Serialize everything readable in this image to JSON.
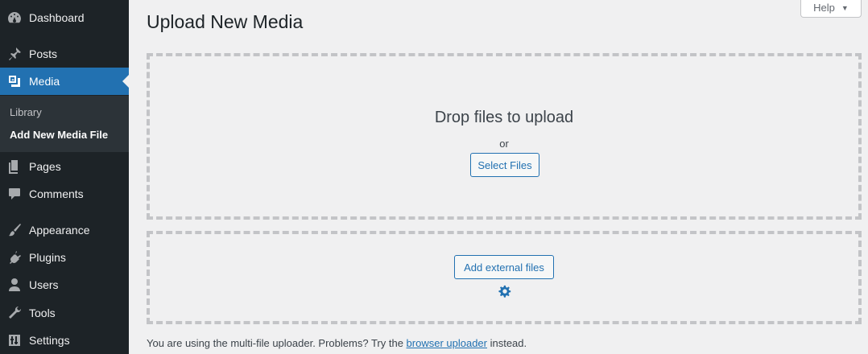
{
  "sidebar": {
    "items": [
      {
        "label": "Dashboard",
        "icon": "dashboard-icon"
      },
      {
        "label": "Posts",
        "icon": "pin-icon"
      },
      {
        "label": "Media",
        "icon": "media-icon"
      },
      {
        "label": "Pages",
        "icon": "pages-icon"
      },
      {
        "label": "Comments",
        "icon": "comment-icon"
      },
      {
        "label": "Appearance",
        "icon": "brush-icon"
      },
      {
        "label": "Plugins",
        "icon": "plug-icon"
      },
      {
        "label": "Users",
        "icon": "user-icon"
      },
      {
        "label": "Tools",
        "icon": "wrench-icon"
      },
      {
        "label": "Settings",
        "icon": "settings-sliders-icon"
      }
    ],
    "submenu": [
      {
        "label": "Library"
      },
      {
        "label": "Add New Media File"
      }
    ],
    "active_item": "Media",
    "current_submenu": "Add New Media File",
    "accent_color": "#2271b1",
    "background_color": "#1d2327"
  },
  "help": {
    "label": "Help",
    "arrow": "▼"
  },
  "page": {
    "title": "Upload New Media"
  },
  "uploader": {
    "drop_text": "Drop files to upload",
    "or_text": "or",
    "select_label": "Select Files",
    "external_label": "Add external files",
    "gear_icon": "gear-icon"
  },
  "footer": {
    "before": "You are using the multi-file uploader. Problems? Try the ",
    "link": "browser uploader",
    "after": " instead."
  }
}
